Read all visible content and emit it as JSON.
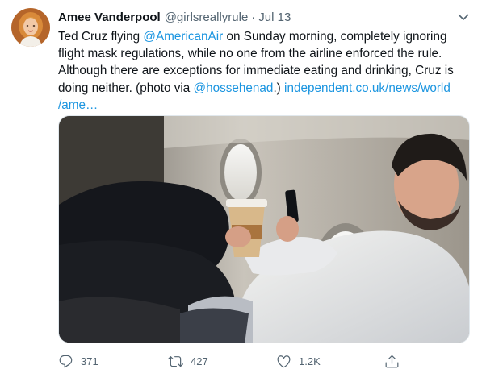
{
  "tweet": {
    "author_name": "Amee Vanderpool",
    "handle": "@girlsreallyrule",
    "separator": "·",
    "time": "Jul 13",
    "line1_a": "Ted Cruz flying ",
    "mention1": "@AmericanAir",
    "line1_b": " on Sunday morning, completely ignoring",
    "line2": "flight mask regulations, while no one from the airline enforced the rule.",
    "line3": "Although there are exceptions for immediate eating and drinking, Cruz is",
    "line4_a": "doing neither. (photo via ",
    "mention2": "@hossehenad",
    "line4_b": ".) ",
    "link_part1": "independent.co.uk/news/world",
    "link_part2": "/ame…"
  },
  "actions": {
    "reply_count": "371",
    "retweet_count": "427",
    "like_count": "1.2K"
  },
  "icons": {
    "avatar": "avatar-photo",
    "more": "chevron-down-icon",
    "reply": "reply-icon",
    "retweet": "retweet-icon",
    "like": "heart-icon",
    "share": "share-icon"
  },
  "colors": {
    "link": "#1b95e0",
    "secondary_text": "#536471",
    "primary_text": "#0f1419"
  }
}
